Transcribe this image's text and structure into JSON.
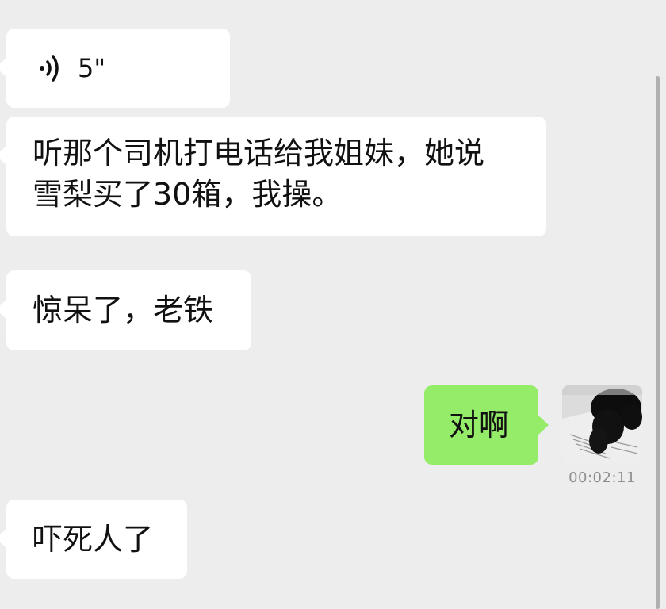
{
  "messages": [
    {
      "side": "left",
      "type": "voice",
      "duration": "5\""
    },
    {
      "side": "left",
      "type": "text",
      "line1": "听那个司机打电话给我姐妹，她说",
      "line2": "雪梨买了30箱，我操。"
    },
    {
      "side": "left",
      "type": "text",
      "text": "惊呆了，老铁"
    },
    {
      "side": "right",
      "type": "text",
      "text": "对啊",
      "time": "00:02:11",
      "avatar": "black-cat-on-book-avatar"
    },
    {
      "side": "left",
      "type": "text",
      "text": "吓死人了"
    }
  ],
  "colors": {
    "background": "#ededed",
    "incoming_bubble": "#ffffff",
    "outgoing_bubble": "#95ec69",
    "timestamp": "#8e8e8e"
  },
  "icons": {
    "voice": "voice-wave-icon"
  }
}
